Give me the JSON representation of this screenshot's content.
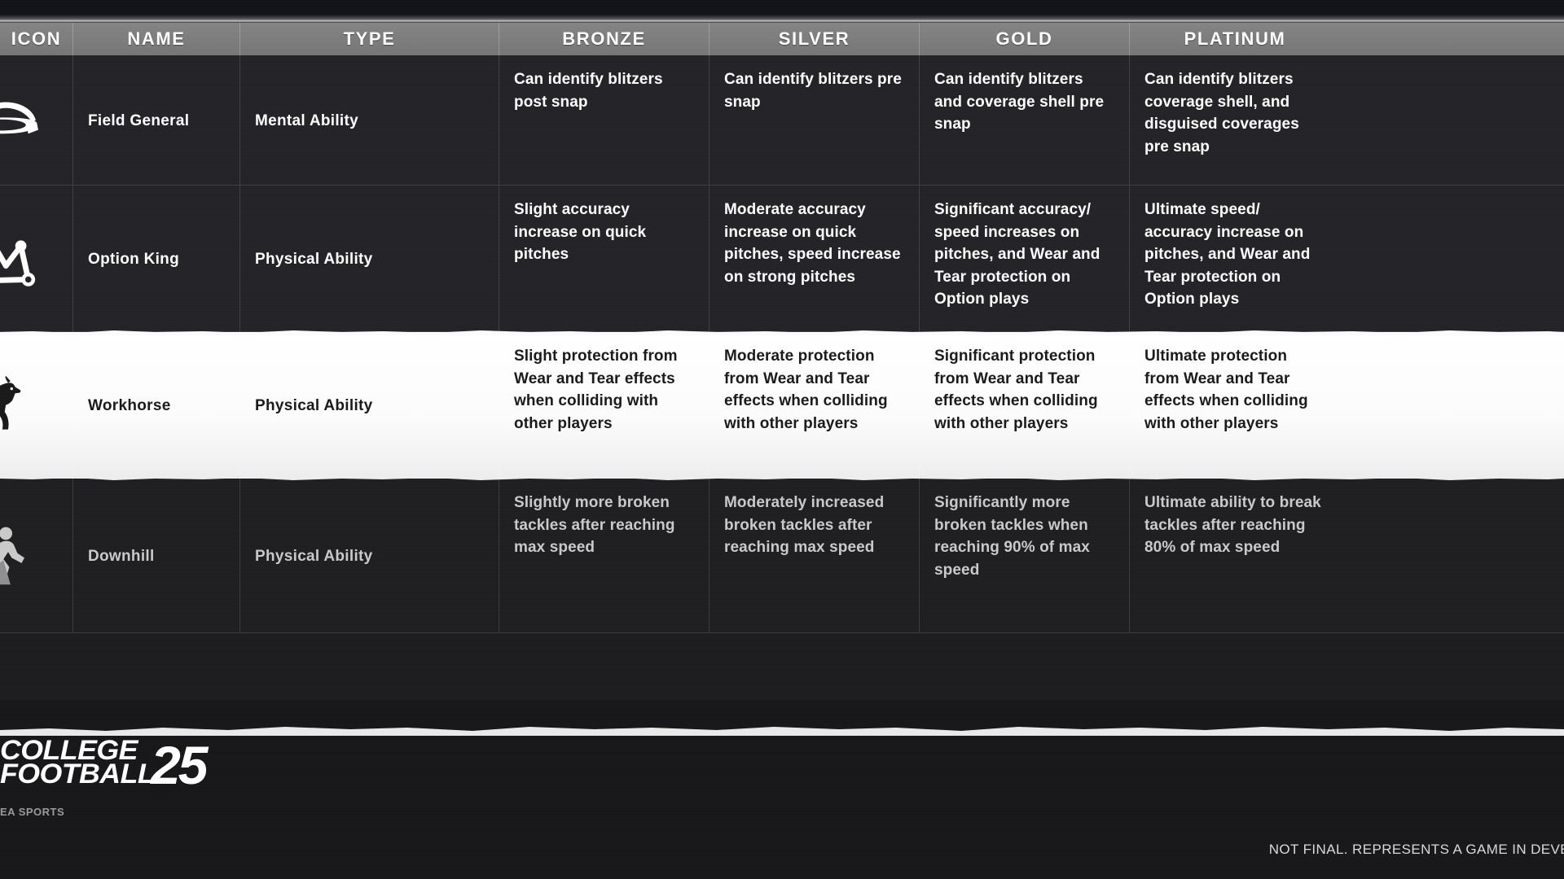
{
  "table": {
    "columns": [
      {
        "key": "icon",
        "label": "ICON"
      },
      {
        "key": "name",
        "label": "NAME"
      },
      {
        "key": "type",
        "label": "TYPE"
      },
      {
        "key": "bronze",
        "label": "BRONZE"
      },
      {
        "key": "silver",
        "label": "SILVER"
      },
      {
        "key": "gold",
        "label": "GOLD"
      },
      {
        "key": "platinum",
        "label": "PLATINUM"
      }
    ],
    "rows": [
      {
        "icon": "general-cap-icon",
        "name": "Field General",
        "type": "Mental Ability",
        "bronze": "Can identify blitzers post snap",
        "silver": "Can identify blitzers pre snap",
        "gold": "Can identify blitzers and coverage shell pre snap",
        "platinum": "Can identify blitzers coverage shell, and disguised coverages pre snap",
        "highlighted": false
      },
      {
        "icon": "option-king-crown-icon",
        "name": "Option King",
        "type": "Physical Ability",
        "bronze": "Slight accuracy increase on quick pitches",
        "silver": "Moderate accuracy increase on quick pitches, speed increase on strong pitches",
        "gold": "Significant accuracy/ speed increases on pitches, and Wear and Tear protection on Option plays",
        "platinum": "Ultimate speed/ accuracy increase on pitches, and Wear and Tear protection on Option plays",
        "highlighted": false
      },
      {
        "icon": "horse-icon",
        "name": "Workhorse",
        "type": "Physical Ability",
        "bronze": "Slight protection from Wear and Tear effects when colliding with other players",
        "silver": "Moderate protection from Wear and Tear effects when colliding with other players",
        "gold": "Significant protection from Wear and Tear effects when colliding with other players",
        "platinum": "Ultimate protection from Wear and Tear effects when colliding with other players",
        "highlighted": true
      },
      {
        "icon": "runner-downhill-icon",
        "name": "Downhill",
        "type": "Physical Ability",
        "bronze": "Slightly more broken tackles after reaching max speed",
        "silver": "Moderately increased broken tackles after reaching max speed",
        "gold": "Significantly more broken tackles when reaching 90% of max speed",
        "platinum": "Ultimate ability to break tackles after reaching 80% of max speed",
        "highlighted": false
      }
    ]
  },
  "footer": {
    "logo": {
      "line1": "COLLEGE",
      "line2": "FOOTBALL",
      "year": "25",
      "publisher": "EA SPORTS"
    },
    "disclaimer": "NOT FINAL. REPRESENTS A GAME IN DEVELOPMENT"
  },
  "colors": {
    "header_bg": "#7a7a7a",
    "row_bg": "#242427",
    "highlight_bg": "#f2f2f2",
    "text_light": "#ffffff",
    "text_dark": "#1a1a1a",
    "band_bg": "#121319"
  }
}
